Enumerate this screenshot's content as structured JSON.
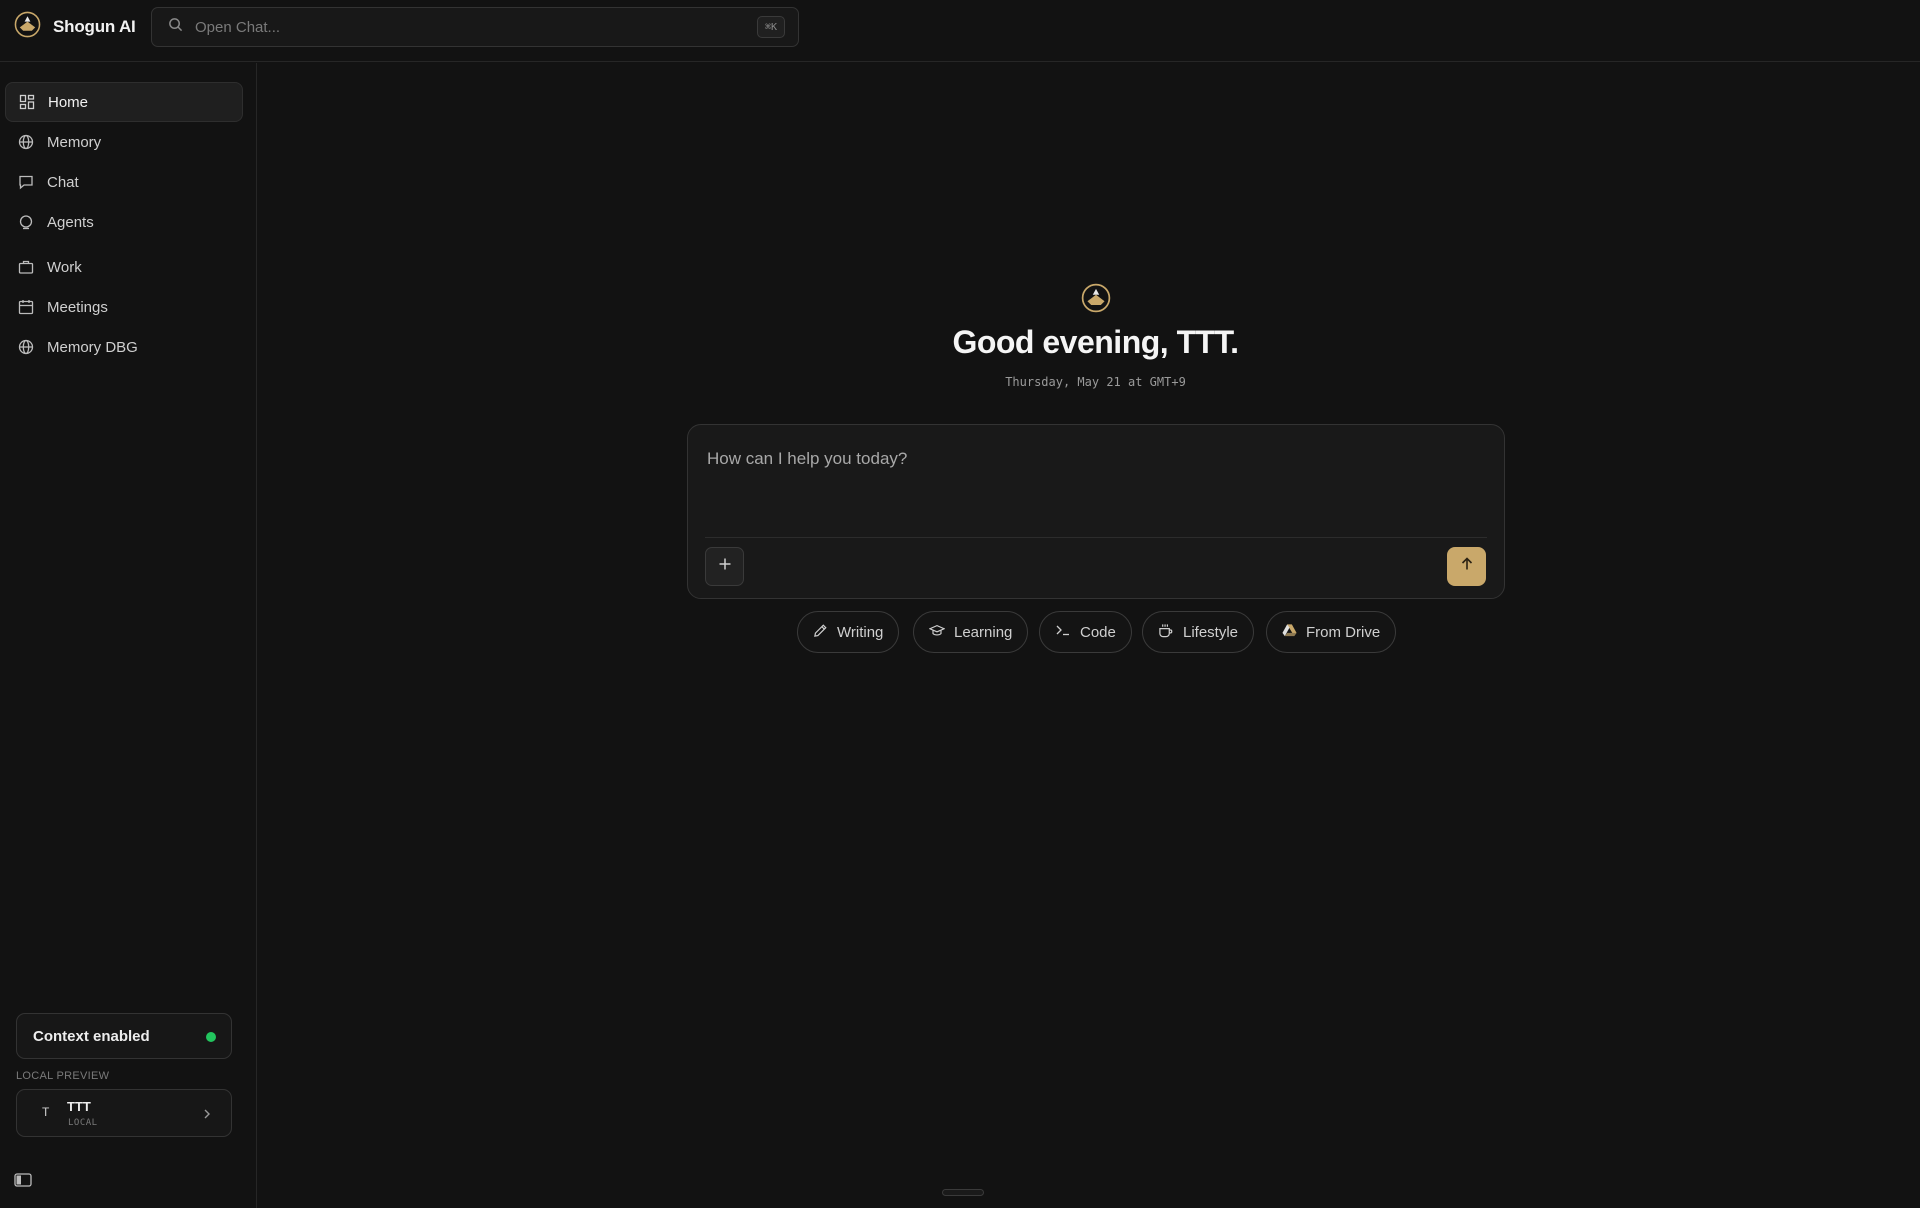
{
  "app": {
    "name": "Shogun AI",
    "logo_icon": "shogun-logo-icon"
  },
  "search": {
    "placeholder": "Open Chat...",
    "shortcut": "⌘K",
    "icon": "search-icon"
  },
  "sidebar": {
    "items": [
      {
        "label": "Home",
        "icon": "grid-icon",
        "active": true
      },
      {
        "label": "Memory",
        "icon": "globe-icon"
      },
      {
        "label": "Chat",
        "icon": "chat-bubble-icon"
      },
      {
        "label": "Agents",
        "icon": "agent-icon"
      },
      {
        "label": "Work",
        "icon": "briefcase-icon"
      },
      {
        "label": "Meetings",
        "icon": "calendar-icon"
      },
      {
        "label": "Memory DBG",
        "icon": "globe-icon"
      }
    ],
    "context": {
      "label": "Context enabled",
      "status_color": "#22c55e"
    },
    "local_preview_label": "LOCAL PREVIEW",
    "user": {
      "initial": "T",
      "name": "TTT",
      "sub": "LOCAL"
    }
  },
  "main": {
    "greeting": "Good evening, TTT.",
    "date": "Thursday, May 21 at GMT+9",
    "composer": {
      "placeholder": "How can I help you today?"
    },
    "chips": [
      {
        "label": "Writing",
        "icon": "pencil-icon"
      },
      {
        "label": "Learning",
        "icon": "graduation-cap-icon"
      },
      {
        "label": "Code",
        "icon": "terminal-icon"
      },
      {
        "label": "Lifestyle",
        "icon": "coffee-cup-icon"
      },
      {
        "label": "From Drive",
        "icon": "drive-icon"
      }
    ]
  },
  "colors": {
    "accent": "#c9a86a",
    "background": "#121212",
    "status": "#22c55e"
  }
}
